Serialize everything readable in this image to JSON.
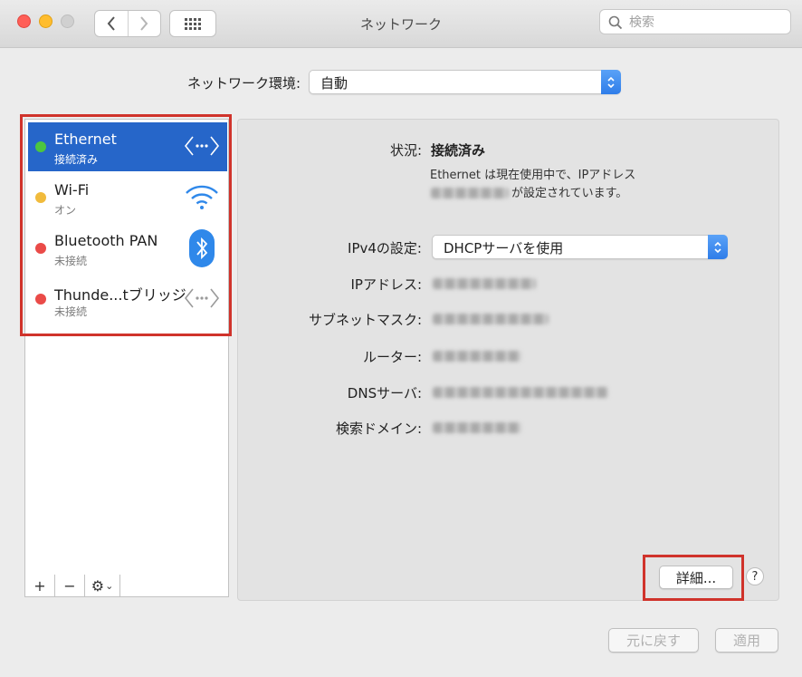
{
  "window": {
    "title": "ネットワーク"
  },
  "search": {
    "placeholder": "検索"
  },
  "location": {
    "label": "ネットワーク環境:",
    "value": "自動"
  },
  "services": [
    {
      "name": "Ethernet",
      "status": "接続済み",
      "dot_color": "#4cc53f",
      "icon": "ethernet-arrows-icon",
      "selected": true
    },
    {
      "name": "Wi-Fi",
      "status": "オン",
      "dot_color": "#f1bb3c",
      "icon": "wifi-icon",
      "selected": false
    },
    {
      "name": "Bluetooth PAN",
      "status": "未接続",
      "dot_color": "#ea4b48",
      "icon": "bluetooth-icon",
      "selected": false
    },
    {
      "name": "Thunde...tブリッジ",
      "status": "未接続",
      "dot_color": "#ea4b48",
      "icon": "bridge-arrows-icon",
      "selected": false
    }
  ],
  "toolbar": {
    "add": "+",
    "remove": "−",
    "gear": "⚙",
    "chevron": "⌄"
  },
  "detail": {
    "status_label": "状況:",
    "status_value": "接続済み",
    "status_note_line1": "Ethernet は現在使用中で、IPアドレス",
    "status_note_line2": "が設定されています。",
    "ipv4_label": "IPv4の設定:",
    "ipv4_value": "DHCPサーバを使用",
    "ip_label": "IPアドレス:",
    "subnet_label": "サブネットマスク:",
    "router_label": "ルーター:",
    "dns_label": "DNSサーバ:",
    "search_domain_label": "検索ドメイン:"
  },
  "buttons": {
    "advanced": "詳細...",
    "help": "?",
    "revert": "元に戻す",
    "apply": "適用"
  },
  "colors": {
    "selection": "#2666c9",
    "highlight_box": "#d0332b",
    "stepper": "#2f7de9"
  }
}
